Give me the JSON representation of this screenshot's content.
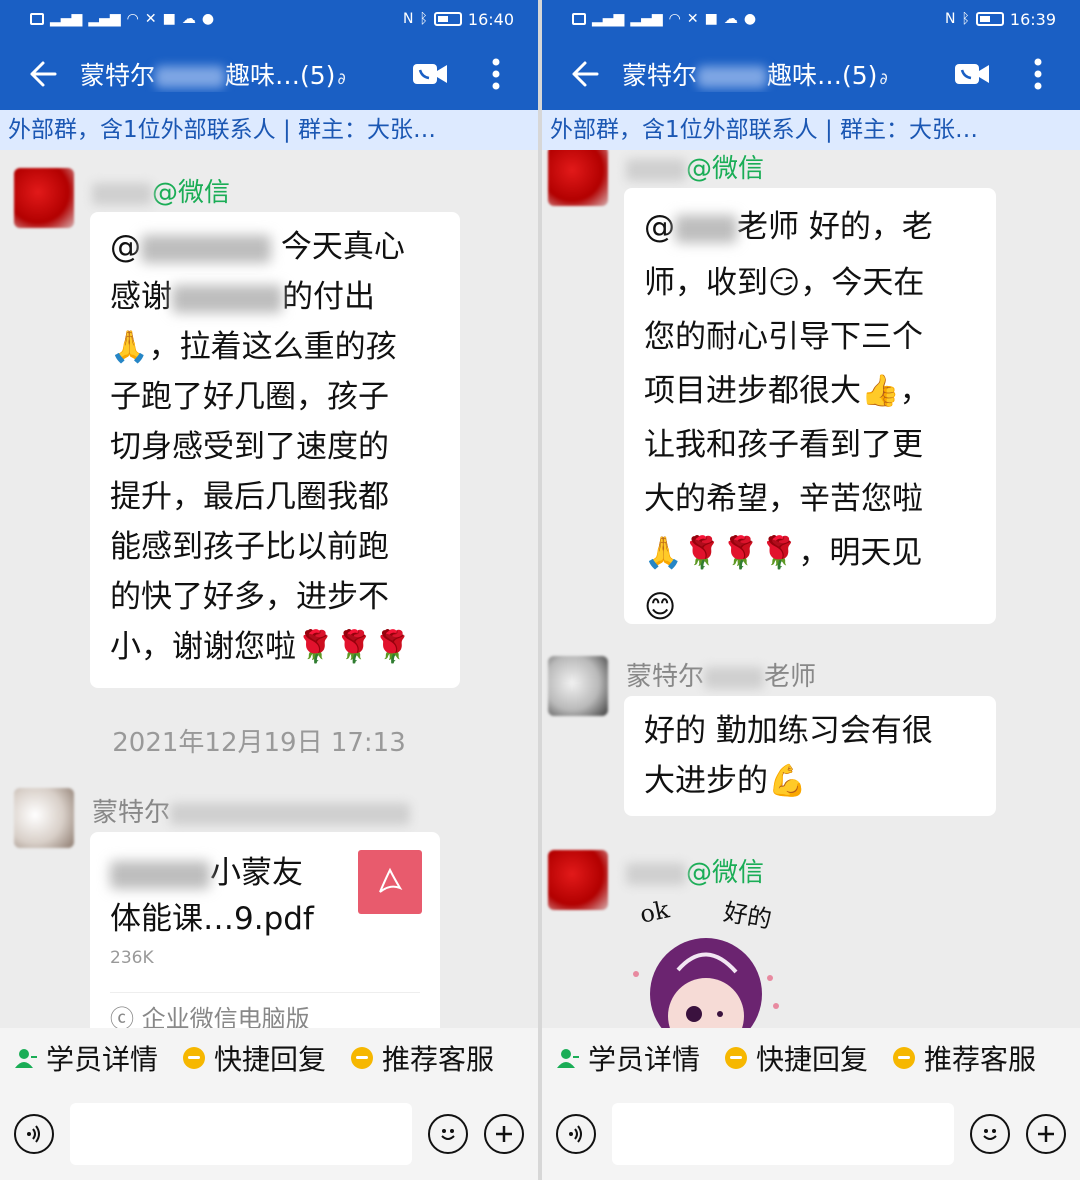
{
  "status_left": {
    "time": "16:40"
  },
  "status_right": {
    "time": "16:39"
  },
  "header": {
    "title_prefix": "蒙特尔",
    "title_suffix": "趣味…(5)",
    "subtitle": "外部群，含1位外部联系人 | 群主：大张…"
  },
  "left": {
    "msg1": {
      "sender_tag": "@微信",
      "line1_prefix": "@",
      "line1_suffix": " 今天真心",
      "line2_prefix": "感谢",
      "line2_suffix": "的付出",
      "line3": "，拉着这么重的孩",
      "line4": "子跑了好几圈，孩子",
      "line5": "切身感受到了速度的",
      "line6": "提升，最后几圈我都",
      "line7": "能感到孩子比以前跑",
      "line8": "的快了好多，进步不",
      "line9": "小，谢谢您啦"
    },
    "timestamp": "2021年12月19日  17:13",
    "msg2": {
      "sender": "蒙特尔",
      "file_name_suffix": "小蒙友",
      "file_name_line2": "体能课…9.pdf",
      "file_size": "236K",
      "file_source": "企业微信电脑版"
    }
  },
  "right": {
    "msg1": {
      "sender_tag": "@微信",
      "line1_prefix": "@",
      "line1_suffix": "老师 好的，老",
      "line2": "师，收到",
      "line2_suffix": "，今天在",
      "line3": "您的耐心引导下三个",
      "line4": "项目进步都很大",
      "line4_suffix": "，",
      "line5": "让我和孩子看到了更",
      "line6": "大的希望，辛苦您啦",
      "line7_suffix": "，明天见"
    },
    "msg2": {
      "sender_prefix": "蒙特尔",
      "sender_suffix": "老师",
      "line1": "好的 勤加练习会有很",
      "line2": "大进步的"
    },
    "msg3": {
      "sender_tag": "@微信",
      "sticker_text_ok": "ok",
      "sticker_text_hao": "好的"
    }
  },
  "quickbar": {
    "chip1": "学员详情",
    "chip2": "快捷回复",
    "chip3": "推荐客服"
  },
  "colors": {
    "header_blue": "#1a5fc4",
    "subbar_bg": "#ddeaff",
    "subbar_text": "#1b57b3",
    "wechat_green": "#1aad56",
    "pdf_red": "#e85b6d"
  }
}
